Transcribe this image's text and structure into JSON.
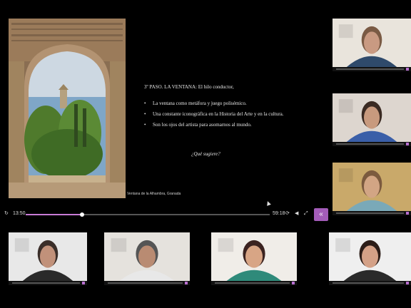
{
  "slide": {
    "heading": "3º PASO. LA VENTANA:  El hilo conductor,",
    "bullets": [
      "La ventana como metáfora y juego polisémico.",
      "Una constante iconográfica en la Historia del Arte y en la cultura.",
      "Son los ojos del artista para asomarnos al mundo."
    ],
    "question": "¿Qué sugiere?",
    "caption": "Ventana de la Alhambra, Granada"
  },
  "player": {
    "elapsed": "13:50",
    "total": "59:18",
    "progress": 0.23,
    "icons": [
      "replay-icon",
      "settings-icon",
      "volume-icon",
      "fullscreen-icon",
      "chevron-left-icon"
    ],
    "accent": "#a35cb8"
  },
  "participants": [
    {
      "name": "participant-1",
      "bg": "#e9e4dc",
      "shirt": "#2f4a6b",
      "skin": "#c99a82",
      "hair": "#7a5a44"
    },
    {
      "name": "participant-2",
      "bg": "#ddd6cf",
      "shirt": "#3a5fa8",
      "skin": "#c89a7e",
      "hair": "#3a2a22"
    },
    {
      "name": "participant-3",
      "bg": "#c9a96a",
      "shirt": "#7aa9b8",
      "skin": "#d2a584",
      "hair": "#7b5a3e"
    },
    {
      "name": "participant-4",
      "bg": "#e8e8e8",
      "shirt": "#2a2a2a",
      "skin": "#c1917a",
      "hair": "#3a2e29"
    },
    {
      "name": "participant-5",
      "bg": "#e5e2dd",
      "shirt": "#e8e8e8",
      "skin": "#b98b72",
      "hair": "#555"
    },
    {
      "name": "participant-6",
      "bg": "#f0ede8",
      "shirt": "#2f8a7a",
      "skin": "#d8a585",
      "hair": "#3b2320"
    },
    {
      "name": "participant-7",
      "bg": "#efefef",
      "shirt": "#2a2a2a",
      "skin": "#d4a187",
      "hair": "#2c1d18"
    }
  ]
}
